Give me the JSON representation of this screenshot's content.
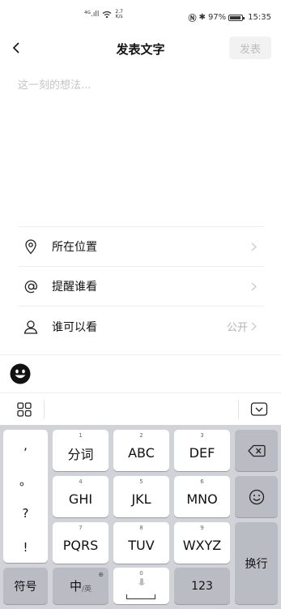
{
  "status_bar": {
    "signal": "⁴ᴳ.ıll",
    "speed_value": "2.7",
    "speed_unit": "K/s",
    "battery": "97%",
    "time": "15:35"
  },
  "header": {
    "title": "发表文字",
    "publish_label": "发表"
  },
  "editor": {
    "placeholder": "这一刻的想法..."
  },
  "options": [
    {
      "label": "所在位置",
      "value": "",
      "icon": "location-icon"
    },
    {
      "label": "提醒谁看",
      "value": "",
      "icon": "at-icon"
    },
    {
      "label": "谁可以看",
      "value": "公开",
      "icon": "person-icon"
    }
  ],
  "keyboard": {
    "symbols": [
      ",",
      "。",
      "?",
      "!"
    ],
    "rows": [
      {
        "num": "1",
        "label": "分词"
      },
      {
        "num": "2",
        "label": "ABC"
      },
      {
        "num": "3",
        "label": "DEF"
      },
      {
        "num": "4",
        "label": "GHI"
      },
      {
        "num": "5",
        "label": "JKL"
      },
      {
        "num": "6",
        "label": "MNO"
      },
      {
        "num": "7",
        "label": "PQRS"
      },
      {
        "num": "8",
        "label": "TUV"
      },
      {
        "num": "9",
        "label": "WXYZ"
      }
    ],
    "newline_label": "换行",
    "symbol_label": "符号",
    "lang_main": "中",
    "lang_sub": "/英",
    "space_num": "0",
    "num_label": "123"
  }
}
